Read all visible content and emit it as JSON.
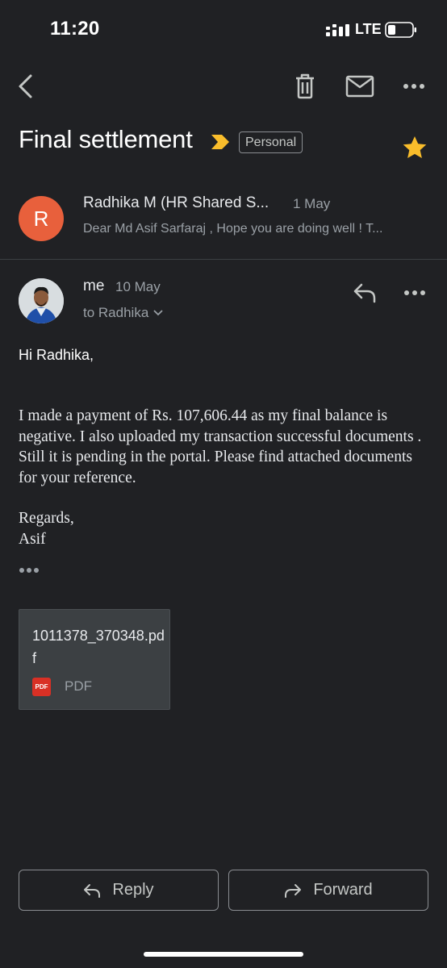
{
  "status_bar": {
    "time": "11:20",
    "network": "LTE"
  },
  "toolbar": {
    "back_icon": "back-arrow-icon",
    "delete_icon": "trash-icon",
    "mark_unread_icon": "mail-icon",
    "more_icon": "more-horizontal-icon"
  },
  "thread": {
    "subject": "Final settlement",
    "label": "Personal",
    "starred": true,
    "colors": {
      "important_marker": "#f9bd2b",
      "star": "#f9bd2b",
      "avatar_r": "#e8603c"
    }
  },
  "messages": [
    {
      "avatar_letter": "R",
      "sender": "Radhika M (HR Shared S...",
      "date": "1 May",
      "snippet": "Dear Md Asif Sarfaraj , Hope you are doing well ! T..."
    },
    {
      "sender": "me",
      "date": "10 May",
      "recipient": "to Radhika",
      "greeting": "Hi Radhika,",
      "body": "I made a payment of Rs. 107,606.44 as my final balance is negative. I also uploaded my transaction successful documents . Still it is pending in the portal. Please find attached documents for your reference.",
      "signoff": "Regards,",
      "signature": "Asif",
      "attachment": {
        "name": "1011378_370348.pdf",
        "badge": "PDF",
        "type": "PDF"
      }
    }
  ],
  "actions": {
    "reply": "Reply",
    "forward": "Forward"
  }
}
